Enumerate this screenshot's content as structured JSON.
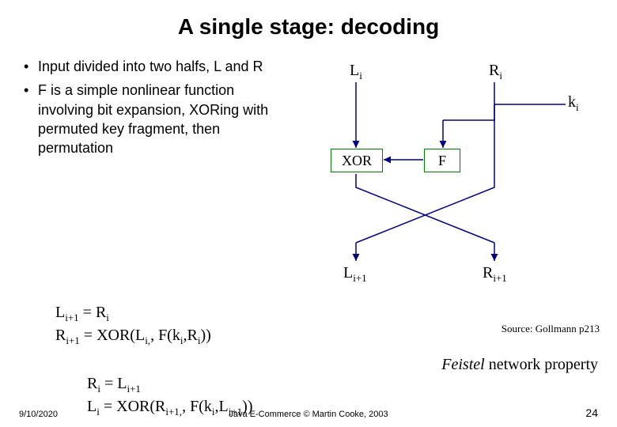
{
  "title": "A single stage: decoding",
  "bullets": [
    "Input divided into two halfs, L and R",
    "F is a simple nonlinear function involving bit expansion, XORing with permuted key fragment, then permutation"
  ],
  "equations_forward": {
    "line1_lhs_base": "L",
    "line1_lhs_sub": "i+1",
    "line1_eq": " = R",
    "line1_rhs_sub": "i",
    "line2_lhs_base": "R",
    "line2_lhs_sub": "i+1",
    "line2_mid": "  = XOR(L",
    "line2_s1": "i,",
    "line2_mid2": ", F(k",
    "line2_s2": "i",
    "line2_mid3": ",R",
    "line2_s3": "i",
    "line2_end": "))"
  },
  "equations_inverse": {
    "line1_lhs_base": "R",
    "line1_lhs_sub": "i",
    "line1_eq": " = L",
    "line1_rhs_sub": "i+1",
    "line2_lhs_base": "L",
    "line2_lhs_sub": "i",
    "line2_mid": "  = XOR(R",
    "line2_s1": "i+1,",
    "line2_mid2": ", F(k",
    "line2_s2": "i",
    "line2_mid3": ",L",
    "line2_s3": "i+1",
    "line2_end": "))"
  },
  "diagram": {
    "Li_base": "L",
    "Li_sub": "i",
    "Ri_base": "R",
    "Ri_sub": "i",
    "ki_base": "k",
    "ki_sub": "i",
    "xor": "XOR",
    "F": "F",
    "Li1_base": "L",
    "Li1_sub": "i+1",
    "Ri1_base": "R",
    "Ri1_sub": "i+1"
  },
  "source": "Source: Gollmann p213",
  "feistel_em": "Feistel",
  "feistel_rest": " network property",
  "footer": {
    "date": "9/10/2020",
    "center": "Java E-Commerce © Martin Cooke, 2003",
    "page": "24"
  },
  "colors": {
    "box": "#008000",
    "line": "#000080"
  }
}
